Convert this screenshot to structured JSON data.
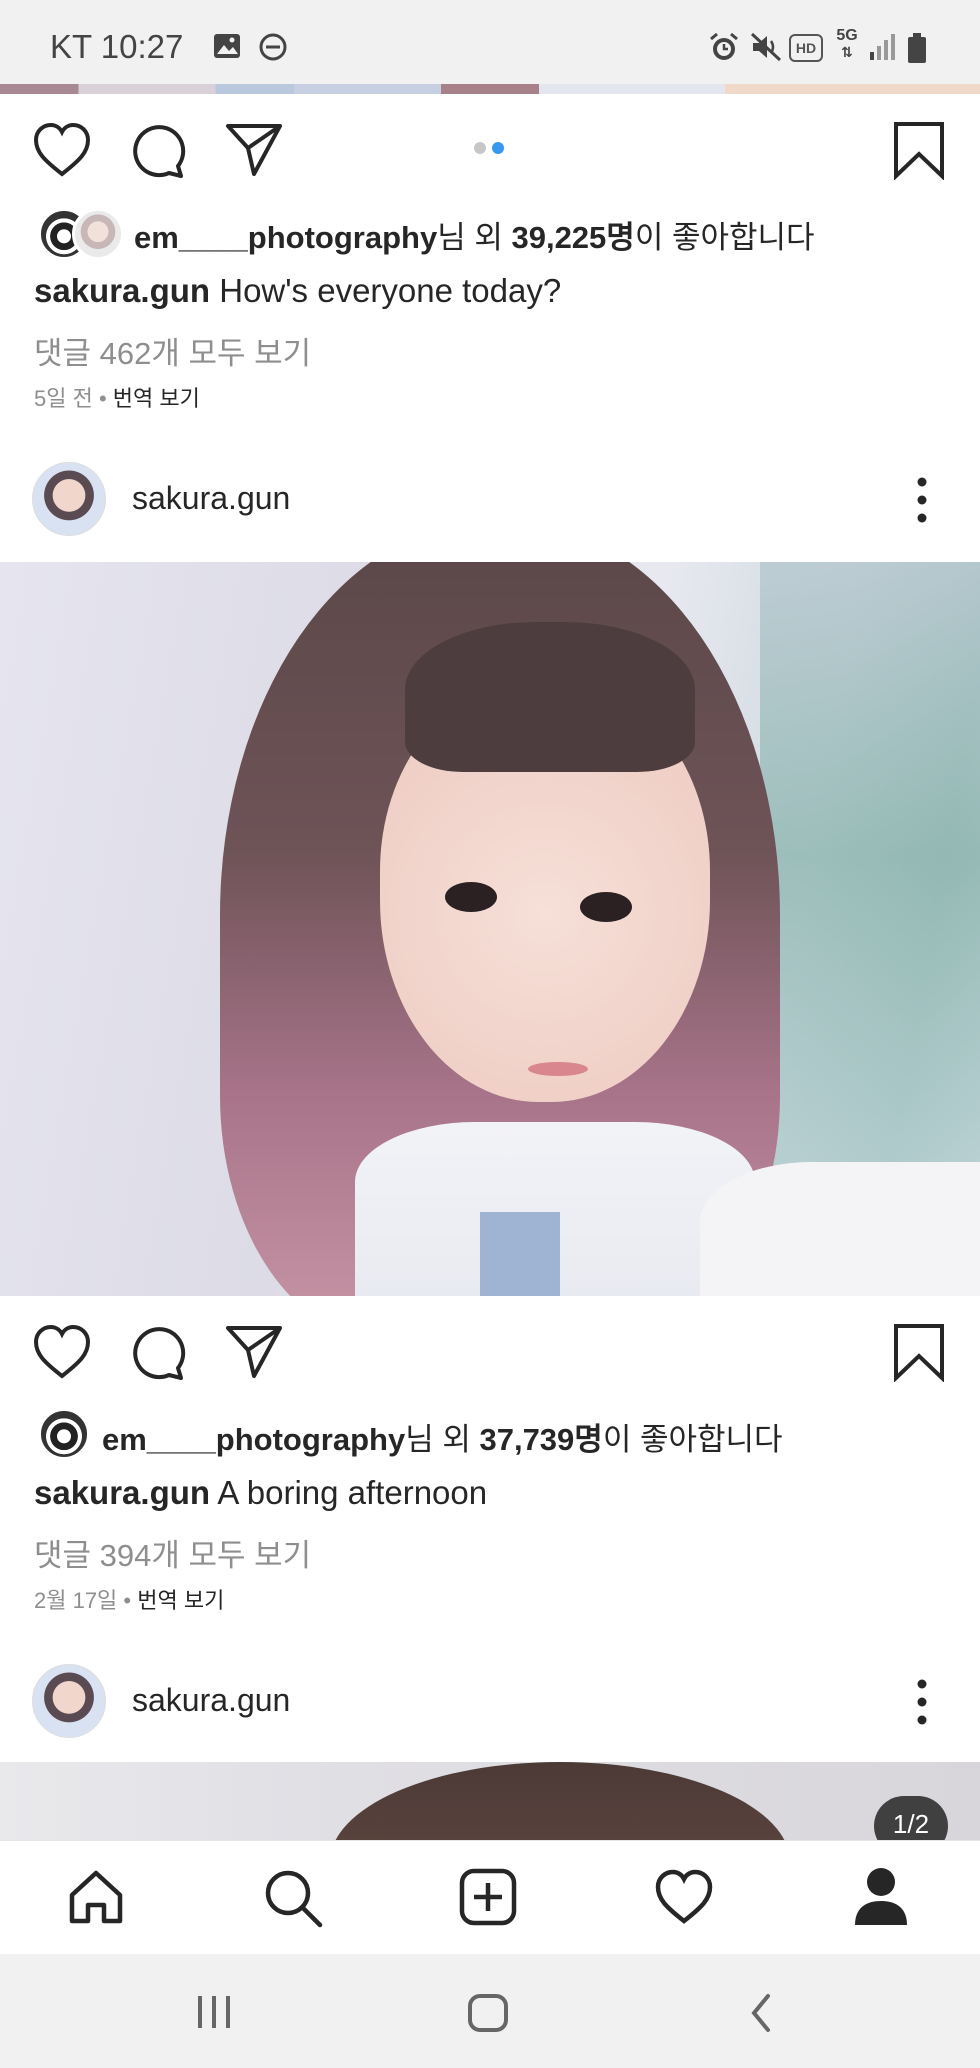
{
  "status_bar": {
    "carrier_time": "KT 10:27",
    "icons": [
      "image-icon",
      "dnd-icon",
      "alarm-icon",
      "mute-icon",
      "hd-icon",
      "5g-icon",
      "signal-icon",
      "battery-icon"
    ],
    "network_label": "5G",
    "hd_label": "HD"
  },
  "post1": {
    "carousel_dots": 2,
    "carousel_active_index": 1,
    "likes_user": "em____photography",
    "likes_mid": "님 외 ",
    "likes_count": "39,225명",
    "likes_tail": "이 좋아합니다",
    "caption_user": "sakura.gun",
    "caption_text": " How's everyone today?",
    "comments_link": "댓글 462개 모두 보기",
    "time_ago": "5일 전",
    "translate_link": "번역 보기"
  },
  "post2": {
    "username": "sakura.gun",
    "likes_user": "em____photography",
    "likes_mid": "님 외 ",
    "likes_count": "37,739명",
    "likes_tail": "이 좋아합니다",
    "caption_user": "sakura.gun",
    "caption_text": " A boring afternoon",
    "comments_link": "댓글 394개 모두 보기",
    "time_ago": "2월 17일",
    "translate_link": "번역 보기"
  },
  "post3": {
    "username": "sakura.gun",
    "carousel_counter": "1/2"
  },
  "bottom_nav": [
    "home-icon",
    "search-icon",
    "new-post-icon",
    "activity-heart-icon",
    "profile-icon"
  ],
  "colors": {
    "accent_blue": "#3897f0",
    "muted_text": "#8e8e8e",
    "text": "#262626"
  }
}
